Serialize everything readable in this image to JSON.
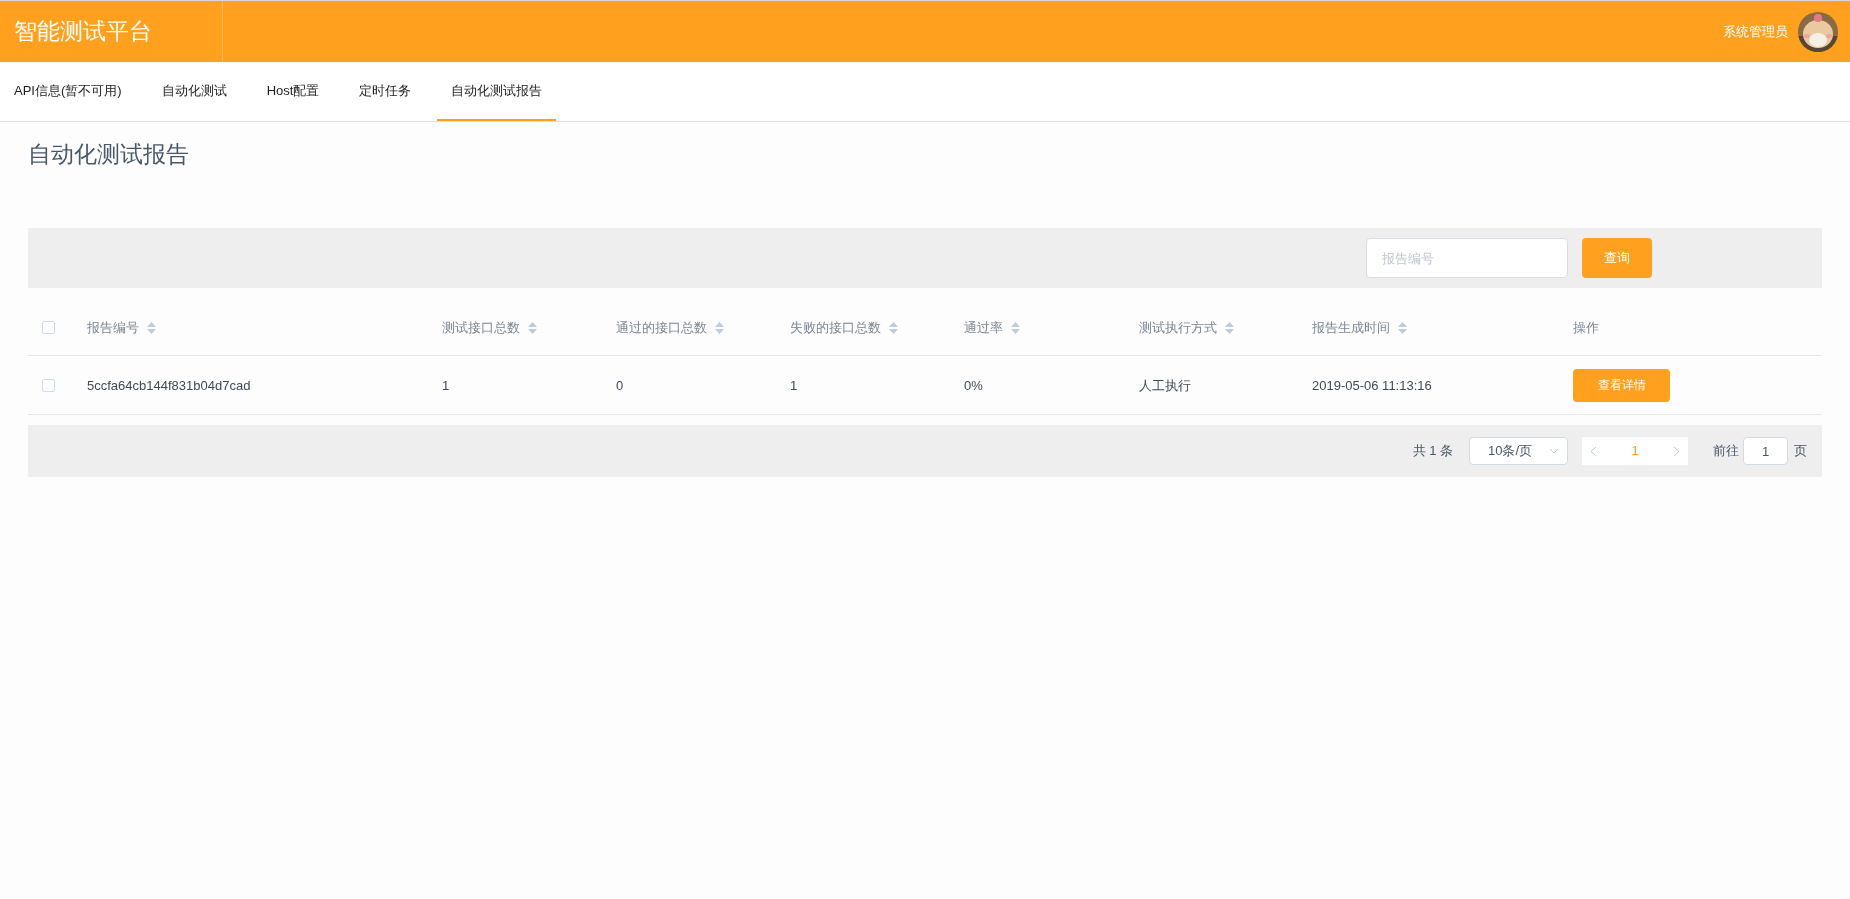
{
  "header": {
    "title": "智能测试平台",
    "user": "系统管理员"
  },
  "tabs": [
    {
      "label": "API信息(暂不可用)",
      "selected": false
    },
    {
      "label": "自动化测试",
      "selected": false
    },
    {
      "label": "Host配置",
      "selected": false
    },
    {
      "label": "定时任务",
      "selected": false
    },
    {
      "label": "自动化测试报告",
      "selected": true
    }
  ],
  "page_title": "自动化测试报告",
  "search": {
    "placeholder": "报告编号",
    "button": "查询"
  },
  "table": {
    "select_all_checked": false,
    "columns": [
      {
        "label": "报告编号",
        "kind": "sortable"
      },
      {
        "label": "测试接口总数",
        "kind": "sortable"
      },
      {
        "label": "通过的接口总数",
        "kind": "sortable"
      },
      {
        "label": "失败的接口总数",
        "kind": "sortable"
      },
      {
        "label": "通过率",
        "kind": "sortable"
      },
      {
        "label": "测试执行方式",
        "kind": "sortable"
      },
      {
        "label": "报告生成时间",
        "kind": "sortable"
      },
      {
        "label": "操作",
        "kind": "plain"
      }
    ],
    "rows": [
      {
        "checked": false,
        "cells": [
          "5ccfa64cb144f831b04d7cad",
          "1",
          "0",
          "1",
          "0%",
          "人工执行",
          "2019-05-06 11:13:16"
        ],
        "action": "查看详情"
      }
    ]
  },
  "pagination": {
    "total": "共 1 条",
    "page_size": "10条/页",
    "current_page": "1",
    "goto_label": "前往",
    "goto_value": "1",
    "page_suffix": "页"
  }
}
